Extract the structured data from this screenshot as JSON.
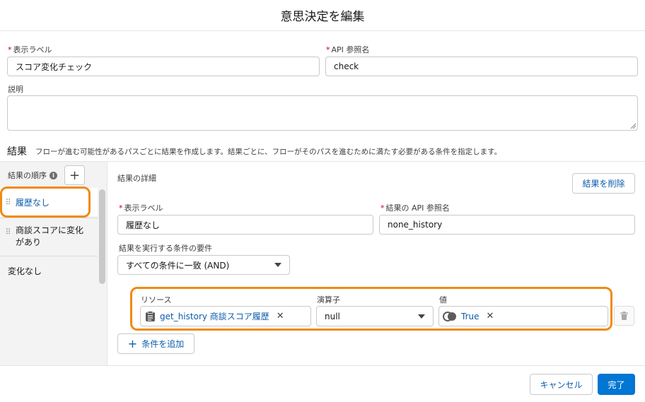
{
  "dialog": {
    "title": "意思決定を編集"
  },
  "form": {
    "label_field": {
      "label": "表示ラベル",
      "value": "スコア変化チェック"
    },
    "api_field": {
      "label": "API 参照名",
      "value": "check"
    },
    "description": {
      "label": "説明",
      "value": ""
    }
  },
  "outcomes_section": {
    "title": "結果",
    "description": "フローが進む可能性があるパスごとに結果を作成します。結果ごとに、フローがそのパスを進むために満たす必要がある条件を指定します。",
    "order_label": "結果の順序",
    "info_glyph": "i",
    "add_glyph": "+",
    "items": [
      {
        "label": "履歴なし"
      },
      {
        "label": "商談スコアに変化",
        "label2": "があり"
      }
    ],
    "default_item": "変化なし"
  },
  "detail": {
    "title": "結果の詳細",
    "delete_button": "結果を削除",
    "label_field": {
      "label": "表示ラベル",
      "value": "履歴なし"
    },
    "api_field": {
      "label": "結果の API 参照名",
      "value": "none_history"
    },
    "requirement": {
      "label": "結果を実行する条件の要件",
      "value": "すべての条件に一致 (AND)"
    },
    "condition": {
      "resource_label": "リソース",
      "operator_label": "演算子",
      "value_label": "値",
      "resource_value": "get_history 商談スコア履歴",
      "operator_value": "null",
      "value_value": "True"
    },
    "add_condition_glyph": "+",
    "add_condition": "条件を追加"
  },
  "footer": {
    "cancel": "キャンセル",
    "done": "完了"
  },
  "colors": {
    "brand": "#0176d3",
    "link": "#0b5cab",
    "highlight": "#f08a12",
    "required": "#ba0517"
  },
  "icons": {
    "resource": "record-collection-icon",
    "value": "boolean-toggle-icon",
    "remove": "close-icon",
    "delete_condition": "trash-icon",
    "grip": "drag-handle-icon"
  }
}
